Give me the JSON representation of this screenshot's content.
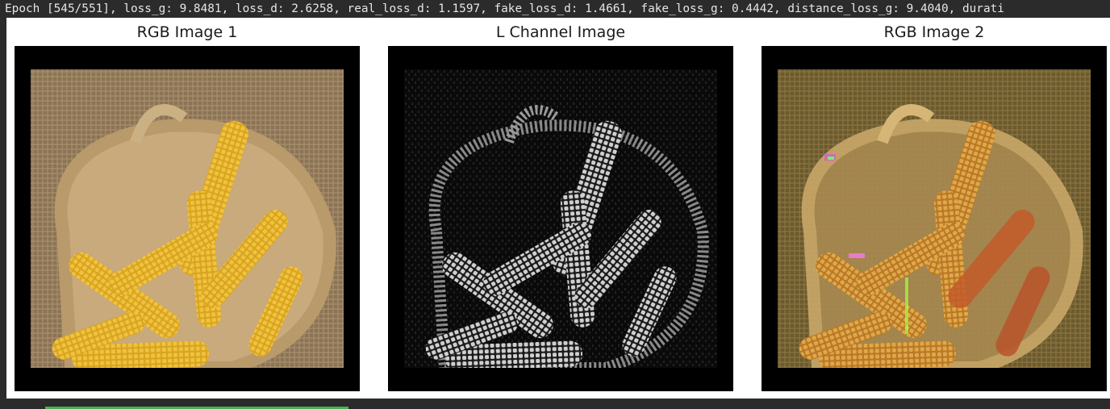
{
  "log": {
    "text": "Epoch [545/551], loss_g: 9.8481, loss_d: 2.6258, real_loss_d: 1.1597, fake_loss_d: 1.4661, fake_loss_g: 0.4442, distance_loss_g: 9.4040, durati"
  },
  "panels": [
    {
      "title": "RGB Image 1"
    },
    {
      "title": "L Channel Image"
    },
    {
      "title": "RGB Image 2"
    }
  ],
  "progress": {
    "fraction": 1.0,
    "color": "#4caf50"
  }
}
